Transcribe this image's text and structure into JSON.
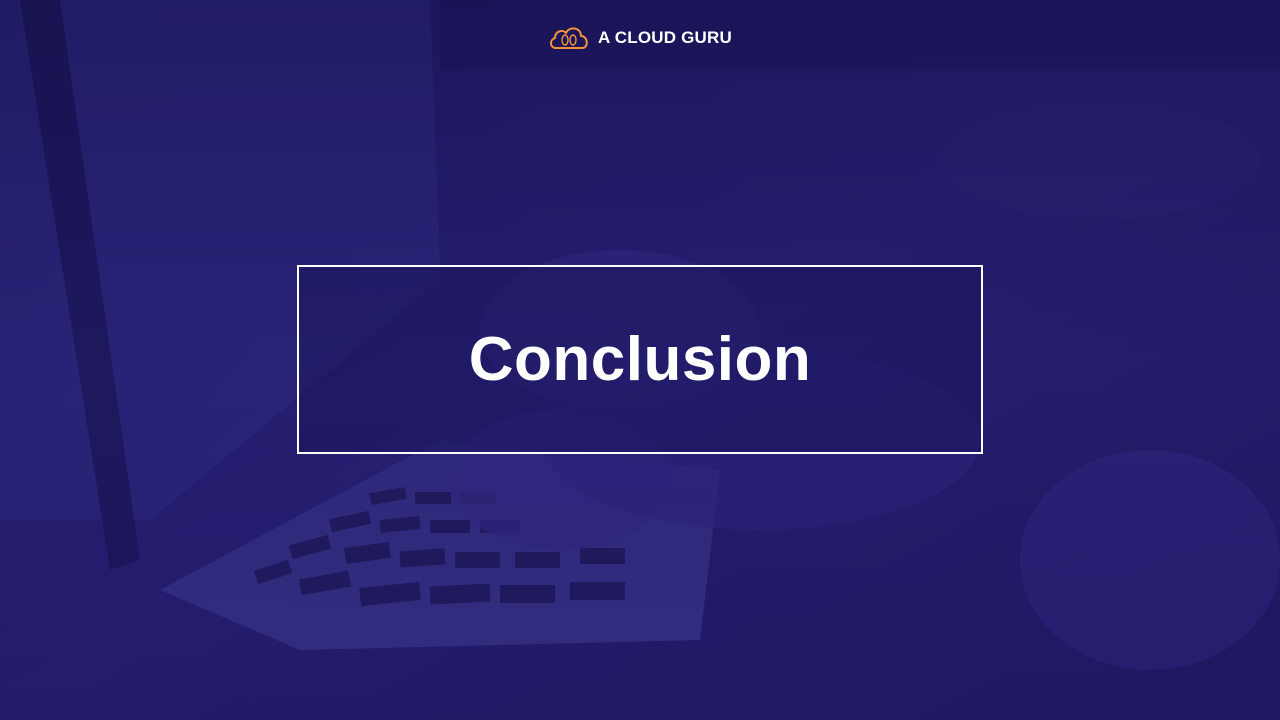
{
  "logo": {
    "text": "A CLOUD GURU",
    "icon": "cloud-guru-icon",
    "icon_color": "#f3923b"
  },
  "slide": {
    "title": "Conclusion"
  },
  "colors": {
    "background": "#1e1a5c",
    "text": "#ffffff",
    "border": "#ffffff"
  }
}
